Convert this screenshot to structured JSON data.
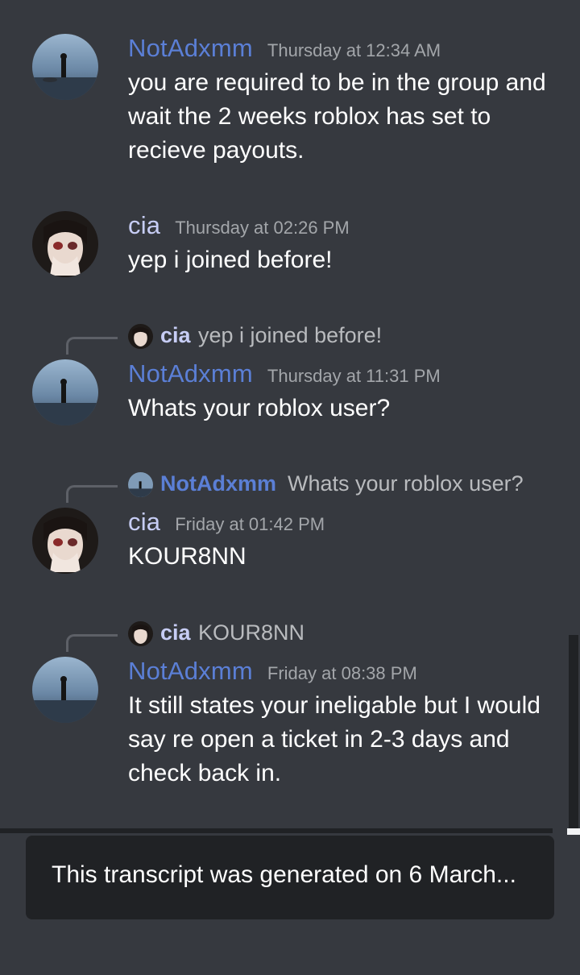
{
  "messages": [
    {
      "author": "NotAdxmm",
      "time": "Thursday at 12:34 AM",
      "text": "you are required to be in the group and wait the 2 weeks roblox has set to recieve payouts."
    },
    {
      "author": "cia",
      "time": "Thursday at 02:26 PM",
      "text": "yep i joined before!"
    },
    {
      "reply_author": "cia",
      "reply_text": "yep i joined before!",
      "author": "NotAdxmm",
      "time": "Thursday at 11:31 PM",
      "text": "Whats your roblox user?"
    },
    {
      "reply_author": "NotAdxmm",
      "reply_text": "Whats your roblox user?",
      "author": "cia",
      "time": "Friday at 01:42 PM",
      "text": "KOUR8NN"
    },
    {
      "reply_author": "cia",
      "reply_text": "KOUR8NN",
      "author": "NotAdxmm",
      "time": "Friday at 08:38 PM",
      "text": "It still states your ineligable but I would say re open a ticket in 2-3 days and check back in."
    }
  ],
  "toast": {
    "text": "This transcript was generated on 6 March..."
  },
  "colors": {
    "background": "#36393f",
    "notadxmm": "#5b7fd6",
    "cia": "#c7cdf5",
    "timestamp": "#a3a6aa",
    "toast_bg": "#202225"
  },
  "icons": {
    "notadxmm_avatar": "figure-on-shore-avatar",
    "cia_avatar": "anime-face-avatar"
  }
}
